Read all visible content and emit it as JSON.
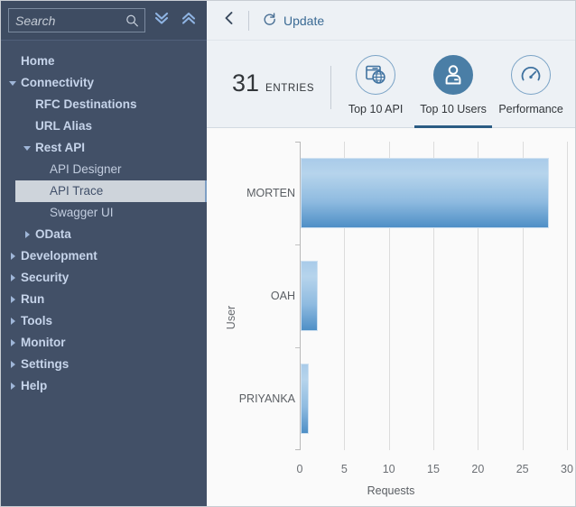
{
  "sidebar": {
    "search": {
      "placeholder": "Search",
      "value": ""
    },
    "collapse_all_label": "Collapse All",
    "expand_all_label": "Expand All",
    "items": [
      {
        "label": "Home",
        "level": 0,
        "state": "leaf",
        "selected": false
      },
      {
        "label": "Connectivity",
        "level": 0,
        "state": "expanded",
        "selected": false
      },
      {
        "label": "RFC Destinations",
        "level": 1,
        "state": "leaf",
        "selected": false
      },
      {
        "label": "URL Alias",
        "level": 1,
        "state": "leaf",
        "selected": false
      },
      {
        "label": "Rest API",
        "level": 1,
        "state": "expanded",
        "selected": false
      },
      {
        "label": "API Designer",
        "level": 2,
        "state": "leaf",
        "selected": false
      },
      {
        "label": "API Trace",
        "level": 2,
        "state": "leaf",
        "selected": true
      },
      {
        "label": "Swagger UI",
        "level": 2,
        "state": "leaf",
        "selected": false
      },
      {
        "label": "OData",
        "level": 1,
        "state": "collapsed",
        "selected": false
      },
      {
        "label": "Development",
        "level": 0,
        "state": "collapsed",
        "selected": false
      },
      {
        "label": "Security",
        "level": 0,
        "state": "collapsed",
        "selected": false
      },
      {
        "label": "Run",
        "level": 0,
        "state": "collapsed",
        "selected": false
      },
      {
        "label": "Tools",
        "level": 0,
        "state": "collapsed",
        "selected": false
      },
      {
        "label": "Monitor",
        "level": 0,
        "state": "collapsed",
        "selected": false
      },
      {
        "label": "Settings",
        "level": 0,
        "state": "collapsed",
        "selected": false
      },
      {
        "label": "Help",
        "level": 0,
        "state": "collapsed",
        "selected": false
      }
    ]
  },
  "toolbar": {
    "back_label": "Back",
    "update_label": "Update"
  },
  "kpi": {
    "count": "31",
    "count_caption": "ENTRIES"
  },
  "tabs": [
    {
      "label": "Top 10 API",
      "icon": "api-globe-icon",
      "active": false
    },
    {
      "label": "Top 10 Users",
      "icon": "user-icon",
      "active": true
    },
    {
      "label": "Performance",
      "icon": "gauge-icon",
      "active": false
    }
  ],
  "colors": {
    "sidebar_bg": "#425067",
    "sidebar_text": "#c6d4ea",
    "selected_bg": "#ced4db",
    "accent": "#4a7ea6",
    "tab_underline": "#2b5c84",
    "bar_top": "#b6d4ec",
    "bar_bottom": "#4e8fc6",
    "grid": "#dcdcdc",
    "panel_bg": "#edf1f5",
    "chart_bg": "#fafafa"
  },
  "chart_data": {
    "type": "bar",
    "orientation": "horizontal",
    "title": "",
    "xlabel": "Requests",
    "ylabel": "User",
    "categories": [
      "MORTEN",
      "OAH",
      "PRIYANKA"
    ],
    "values": [
      28,
      2,
      1
    ],
    "series": [
      {
        "name": "Requests",
        "values": [
          28,
          2,
          1
        ]
      }
    ],
    "xlim": [
      0,
      30
    ],
    "xticks": [
      0,
      5,
      10,
      15,
      20,
      25,
      30
    ],
    "xtick_labels": [
      "0",
      "5",
      "10",
      "15",
      "20",
      "25",
      "30"
    ],
    "grid": "vertical",
    "legend": "none"
  }
}
